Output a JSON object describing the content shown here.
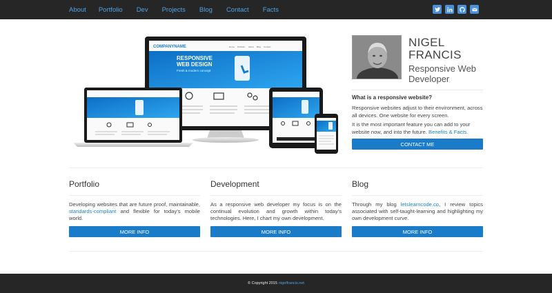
{
  "nav": {
    "links": [
      "About",
      "Portfolio",
      "Dev",
      "Projects",
      "Blog",
      "Contact",
      "Facts"
    ],
    "social": [
      "twitter-icon",
      "linkedin-icon",
      "github-icon",
      "email-icon"
    ]
  },
  "hero": {
    "screen": {
      "brand": "COMPANYNAME",
      "headline_1": "RESPONSIVE",
      "headline_2": "WEB DESIGN",
      "tagline": "Fresh & modern concept",
      "menu": [
        "Home",
        "Portfolio",
        "About",
        "Blog",
        "Contact"
      ]
    }
  },
  "profile": {
    "name_line1": "NIGEL",
    "name_line2": "FRANCIS",
    "role_line1": "Responsive Web",
    "role_line2": "Developer",
    "question": "What is a responsive website?",
    "para1": "Responsive websites adjust to their environment, across all devices. One website for every screen.",
    "para2_text": "It is the most important feature you can add to your website now, and into the future.",
    "para2_link": "Benefits & Facts.",
    "contact_label": "CONTACT ME"
  },
  "columns": [
    {
      "title": "Portfolio",
      "text_before": "Developing websites that are future proof, maintainable,",
      "link": "standards-compliant",
      "text_after": "and flexible for today's mobile world.",
      "button": "MORE INFO"
    },
    {
      "title": "Development",
      "text_before": "As a responsive web developer my focus is on the continual evolution and growth within today's technologies. Here, I chart my own development.",
      "link": "",
      "text_after": "",
      "button": "MORE INFO"
    },
    {
      "title": "Blog",
      "text_before": "Through my blog",
      "link": "letslearncode.co",
      "text_after": ", I review topics associated with self-taught-learning and highlighting my own development curve.",
      "button": "MORE INFO"
    }
  ],
  "footer": {
    "copyright": "© Copyright 2015",
    "link": "nigelfrancis.net"
  },
  "colors": {
    "nav_bg": "#262626",
    "accent": "#1a7cc9",
    "link": "#1a86d0"
  }
}
